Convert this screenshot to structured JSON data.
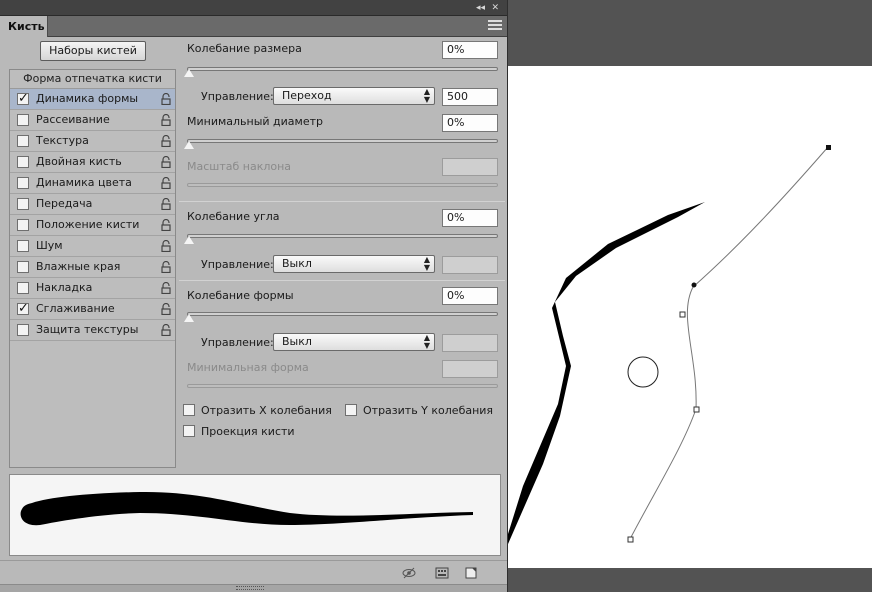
{
  "panel": {
    "tab_label": "Кисть",
    "presets_button": "Наборы кистей",
    "list_header": "Форма отпечатка кисти",
    "items": [
      {
        "label": "Динамика формы",
        "checked": true,
        "selected": true
      },
      {
        "label": "Рассеивание",
        "checked": false,
        "selected": false
      },
      {
        "label": "Текстура",
        "checked": false,
        "selected": false
      },
      {
        "label": "Двойная кисть",
        "checked": false,
        "selected": false
      },
      {
        "label": "Динамика цвета",
        "checked": false,
        "selected": false
      },
      {
        "label": "Передача",
        "checked": false,
        "selected": false
      },
      {
        "label": "Положение кисти",
        "checked": false,
        "selected": false
      },
      {
        "label": "Шум",
        "checked": false,
        "selected": false
      },
      {
        "label": "Влажные края",
        "checked": false,
        "selected": false
      },
      {
        "label": "Накладка",
        "checked": false,
        "selected": false
      },
      {
        "label": "Сглаживание",
        "checked": true,
        "selected": false
      },
      {
        "label": "Защита текстуры",
        "checked": false,
        "selected": false
      }
    ]
  },
  "settings": {
    "size_jitter": {
      "label": "Колебание размера",
      "value": "0%"
    },
    "control1": {
      "label": "Управление:",
      "value": "Переход",
      "steps": "500"
    },
    "min_diameter": {
      "label": "Минимальный диаметр",
      "value": "0%"
    },
    "tilt_scale": {
      "label": "Масштаб наклона",
      "value": ""
    },
    "angle_jitter": {
      "label": "Колебание угла",
      "value": "0%"
    },
    "control2": {
      "label": "Управление:",
      "value": "Выкл",
      "extra": ""
    },
    "roundness_jitter": {
      "label": "Колебание формы",
      "value": "0%"
    },
    "control3": {
      "label": "Управление:",
      "value": "Выкл",
      "extra": ""
    },
    "min_roundness": {
      "label": "Минимальная форма",
      "value": ""
    },
    "flip_x": "Отразить X колебания",
    "flip_y": "Отразить Y колебания",
    "brush_projection": "Проекция кисти"
  },
  "icons": {
    "lock": "lock-icon",
    "menu": "panel-menu-icon",
    "collapse": "collapse-icon",
    "close": "close-icon",
    "eye": "toggle-preview-icon",
    "grid": "brush-editor-icon",
    "new": "new-preset-icon"
  },
  "colors": {
    "panel_bg": "#b9b9b9",
    "selection": "#a9b6cb",
    "workspace": "#535353"
  }
}
